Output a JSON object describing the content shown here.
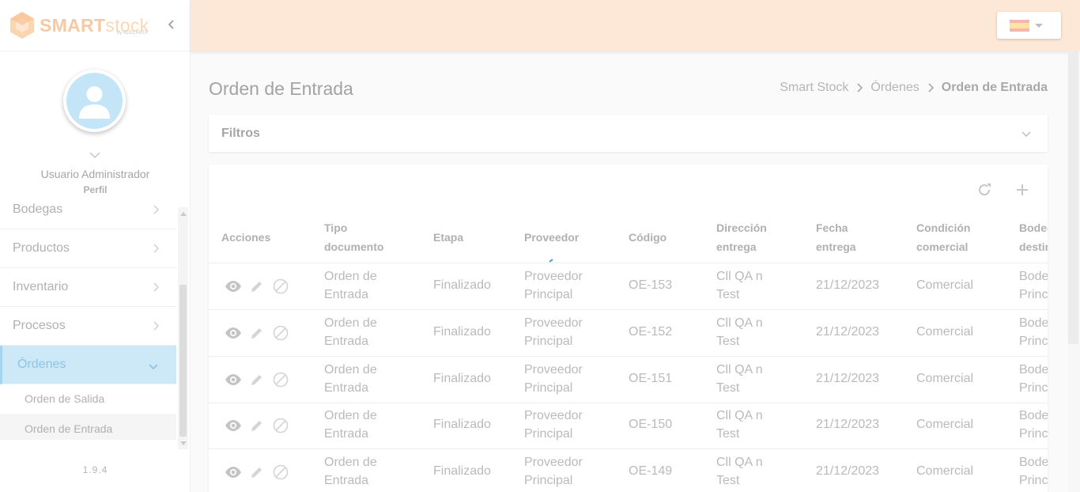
{
  "app": {
    "brand_main": "SMART",
    "brand_stock": "stock",
    "brand_sub": "by ADELANTA"
  },
  "colors": {
    "topbar": "#fde7d6",
    "active_menu": "#cde8f7",
    "accent": "#8fc4e5"
  },
  "profile": {
    "name": "Usuario Administrador",
    "role": "Perfil"
  },
  "menu": {
    "items": [
      {
        "label": "Bodegas",
        "icon": "chevron-right-icon"
      },
      {
        "label": "Productos",
        "icon": "chevron-right-icon"
      },
      {
        "label": "Inventario",
        "icon": "chevron-right-icon"
      },
      {
        "label": "Procesos",
        "icon": "chevron-right-icon"
      },
      {
        "label": "Órdenes",
        "icon": "chevron-down-icon"
      }
    ],
    "subitems": [
      {
        "label": "Orden de Salida"
      },
      {
        "label": "Orden de Entrada"
      }
    ]
  },
  "version": "1.9.4",
  "header": {
    "language_flag": "spain-flag-icon"
  },
  "page": {
    "title": "Orden de Entrada"
  },
  "breadcrumb": {
    "items": [
      "Smart Stock",
      "Órdenes",
      "Orden de Entrada"
    ]
  },
  "filters": {
    "title": "Filtros"
  },
  "table": {
    "columns": [
      {
        "line1": "Acciones",
        "line2": ""
      },
      {
        "line1": "Tipo",
        "line2": "documento"
      },
      {
        "line1": "Etapa",
        "line2": ""
      },
      {
        "line1": "Proveedor",
        "line2": ""
      },
      {
        "line1": "Código",
        "line2": ""
      },
      {
        "line1": "Dirección",
        "line2": "entrega"
      },
      {
        "line1": "Fecha",
        "line2": "entrega"
      },
      {
        "line1": "Condición",
        "line2": "comercial"
      },
      {
        "line1": "Bodeg",
        "line2": "destin"
      }
    ],
    "rows": [
      {
        "tipo1": "Orden de",
        "tipo2": "Entrada",
        "etapa": "Finalizado",
        "prov1": "Proveedor",
        "prov2": "Principal",
        "codigo": "OE-153",
        "dir1": "Cll QA n",
        "dir2": "Test",
        "fecha": "21/12/2023",
        "condicion": "Comercial",
        "bod1": "Bode",
        "bod2": "Princ"
      },
      {
        "tipo1": "Orden de",
        "tipo2": "Entrada",
        "etapa": "Finalizado",
        "prov1": "Proveedor",
        "prov2": "Principal",
        "codigo": "OE-152",
        "dir1": "Cll QA n",
        "dir2": "Test",
        "fecha": "21/12/2023",
        "condicion": "Comercial",
        "bod1": "Bode",
        "bod2": "Princ"
      },
      {
        "tipo1": "Orden de",
        "tipo2": "Entrada",
        "etapa": "Finalizado",
        "prov1": "Proveedor",
        "prov2": "Principal",
        "codigo": "OE-151",
        "dir1": "Cll QA n",
        "dir2": "Test",
        "fecha": "21/12/2023",
        "condicion": "Comercial",
        "bod1": "Bode",
        "bod2": "Princ"
      },
      {
        "tipo1": "Orden de",
        "tipo2": "Entrada",
        "etapa": "Finalizado",
        "prov1": "Proveedor",
        "prov2": "Principal",
        "codigo": "OE-150",
        "dir1": "Cll QA n",
        "dir2": "Test",
        "fecha": "21/12/2023",
        "condicion": "Comercial",
        "bod1": "Bode",
        "bod2": "Princ"
      },
      {
        "tipo1": "Orden de",
        "tipo2": "Entrada",
        "etapa": "Finalizado",
        "prov1": "Proveedor",
        "prov2": "Principal",
        "codigo": "OE-149",
        "dir1": "Cll QA n",
        "dir2": "Test",
        "fecha": "21/12/2023",
        "condicion": "Comercial",
        "bod1": "Bode",
        "bod2": "Princ"
      }
    ]
  }
}
